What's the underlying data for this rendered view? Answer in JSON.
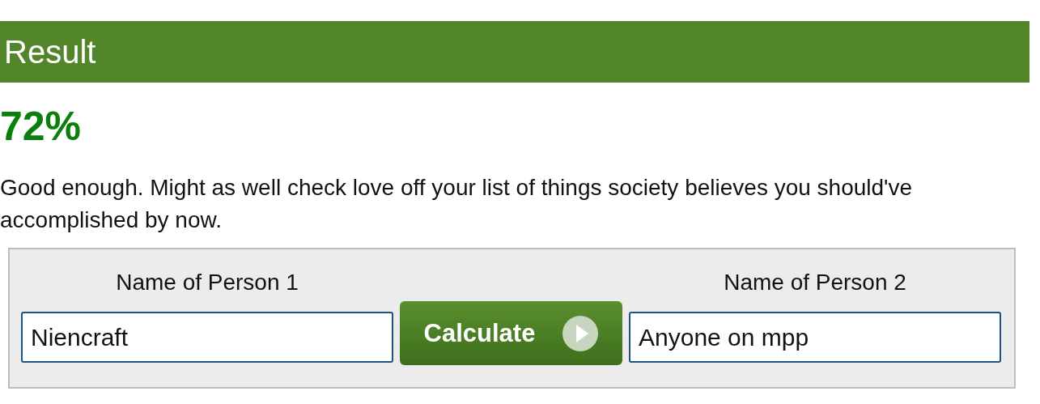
{
  "header": {
    "title": "Result"
  },
  "score": "72%",
  "message": "Good enough. Might as well check love off your list of things society believes you should've accomplished by now.",
  "form": {
    "person1": {
      "label": "Name of Person 1",
      "value": "Niencraft"
    },
    "button": "Calculate",
    "person2": {
      "label": "Name of Person 2",
      "value": "Anyone on mpp"
    }
  }
}
